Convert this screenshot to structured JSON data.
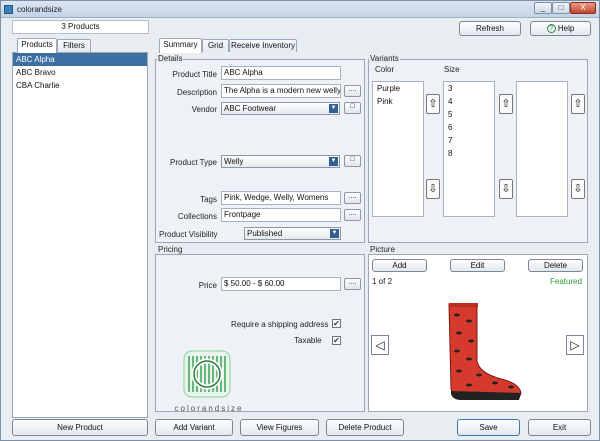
{
  "window": {
    "title": "colorandsize",
    "min": "_",
    "max": "□",
    "close": "X"
  },
  "toolbar": {
    "refresh": "Refresh",
    "help": "Help"
  },
  "products": {
    "count": "3 Products",
    "tabs": [
      "Products",
      "Filters"
    ],
    "items": [
      "ABC Alpha",
      "ABC Bravo",
      "CBA Charlie"
    ],
    "selected_index": 0
  },
  "detail_tabs": [
    "Summary",
    "Grid",
    "Receive Inventory"
  ],
  "details": {
    "section": "Details",
    "title_label": "Product Title",
    "title_value": "ABC Alpha",
    "description_label": "Description",
    "description_value": "The Alpha is a modern new welly c",
    "vendor_label": "Vendor",
    "vendor_value": "ABC Footwear",
    "type_label": "Product Type",
    "type_value": "Welly",
    "tags_label": "Tags",
    "tags_value": "Pink, Wedge, Welly, Womens",
    "collections_label": "Collections",
    "collections_value": "Frontpage",
    "visibility_label": "Product Visibility",
    "visibility_value": "Published",
    "more": "...."
  },
  "variants": {
    "section": "Variants",
    "color_header": "Color",
    "size_header": "Size",
    "colors": [
      "Purple",
      "Pink"
    ],
    "sizes": [
      "3",
      "4",
      "5",
      "6",
      "7",
      "8"
    ]
  },
  "pricing": {
    "section": "Pricing",
    "price_label": "Price",
    "price_value": "$ 50.00 - $ 60.00",
    "shipping_label": "Require a shipping address",
    "taxable_label": "Taxable",
    "shipping_checked": true,
    "taxable_checked": true
  },
  "logo": {
    "text": "colorandsize"
  },
  "picture": {
    "section": "Picture",
    "add": "Add",
    "edit": "Edit",
    "delete": "Delete",
    "counter": "1 of 2",
    "featured": "Featured",
    "featured_color": "#2e9a3a"
  },
  "bottom": {
    "new_product": "New Product",
    "add_variant": "Add Variant",
    "view_figures": "View Figures",
    "delete_product": "Delete Product",
    "save": "Save",
    "exit": "Exit"
  },
  "colors": {
    "accent": "#3d6fa3",
    "boot": "#d63a2c"
  }
}
